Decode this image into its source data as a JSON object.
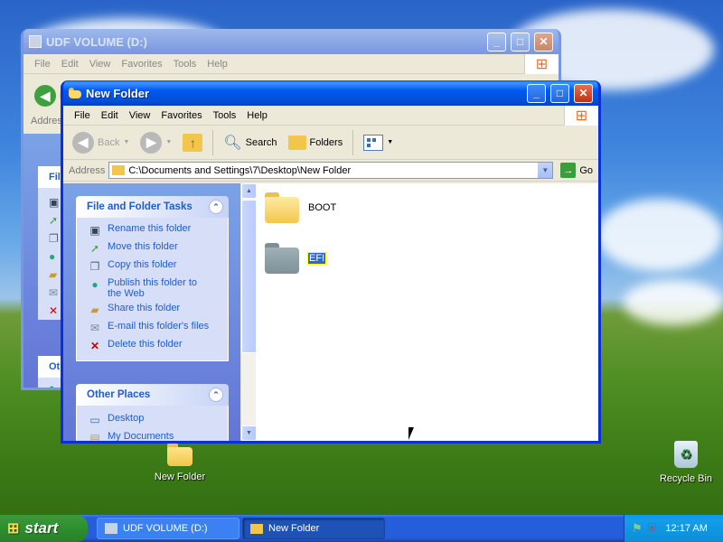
{
  "desktop": {
    "icons": [
      {
        "label": "New Folder",
        "icon": "folder-icon"
      },
      {
        "label": "Recycle Bin",
        "icon": "recycle-bin-icon"
      }
    ]
  },
  "back_window": {
    "title": "UDF VOLUME (D:)",
    "menu": [
      "File",
      "Edit",
      "View",
      "Favorites",
      "Tools",
      "Help"
    ],
    "partial_labels": {
      "back": "B",
      "address": "Addres",
      "file_panel": "File",
      "other_panel": "Oth"
    }
  },
  "front_window": {
    "title": "New Folder",
    "menu": [
      "File",
      "Edit",
      "View",
      "Favorites",
      "Tools",
      "Help"
    ],
    "toolbar": {
      "back": "Back",
      "search": "Search",
      "folders": "Folders"
    },
    "address": {
      "label": "Address",
      "value": "C:\\Documents and Settings\\7\\Desktop\\New Folder",
      "go": "Go"
    },
    "file_tasks": {
      "title": "File and Folder Tasks",
      "items": [
        {
          "label": "Rename this folder",
          "icon": "rename-icon"
        },
        {
          "label": "Move this folder",
          "icon": "move-icon"
        },
        {
          "label": "Copy this folder",
          "icon": "copy-icon"
        },
        {
          "label": "Publish this folder to the Web",
          "icon": "globe-icon"
        },
        {
          "label": "Share this folder",
          "icon": "share-icon"
        },
        {
          "label": "E-mail this folder's files",
          "icon": "email-icon"
        },
        {
          "label": "Delete this folder",
          "icon": "delete-icon"
        }
      ]
    },
    "other_places": {
      "title": "Other Places",
      "items": [
        {
          "label": "Desktop",
          "icon": "desktop-icon"
        },
        {
          "label": "My Documents",
          "icon": "documents-icon"
        }
      ]
    },
    "files": [
      {
        "name": "BOOT",
        "selected": false
      },
      {
        "name": "EFI",
        "selected": true
      }
    ]
  },
  "taskbar": {
    "start": "start",
    "buttons": [
      {
        "label": "UDF VOLUME (D:)",
        "active": false
      },
      {
        "label": "New Folder",
        "active": true
      }
    ],
    "clock": "12:17 AM"
  },
  "colors": {
    "accent": "#0058ee",
    "taskbar": "#245edb",
    "start": "#2d8f2d",
    "link": "#215dc6"
  }
}
